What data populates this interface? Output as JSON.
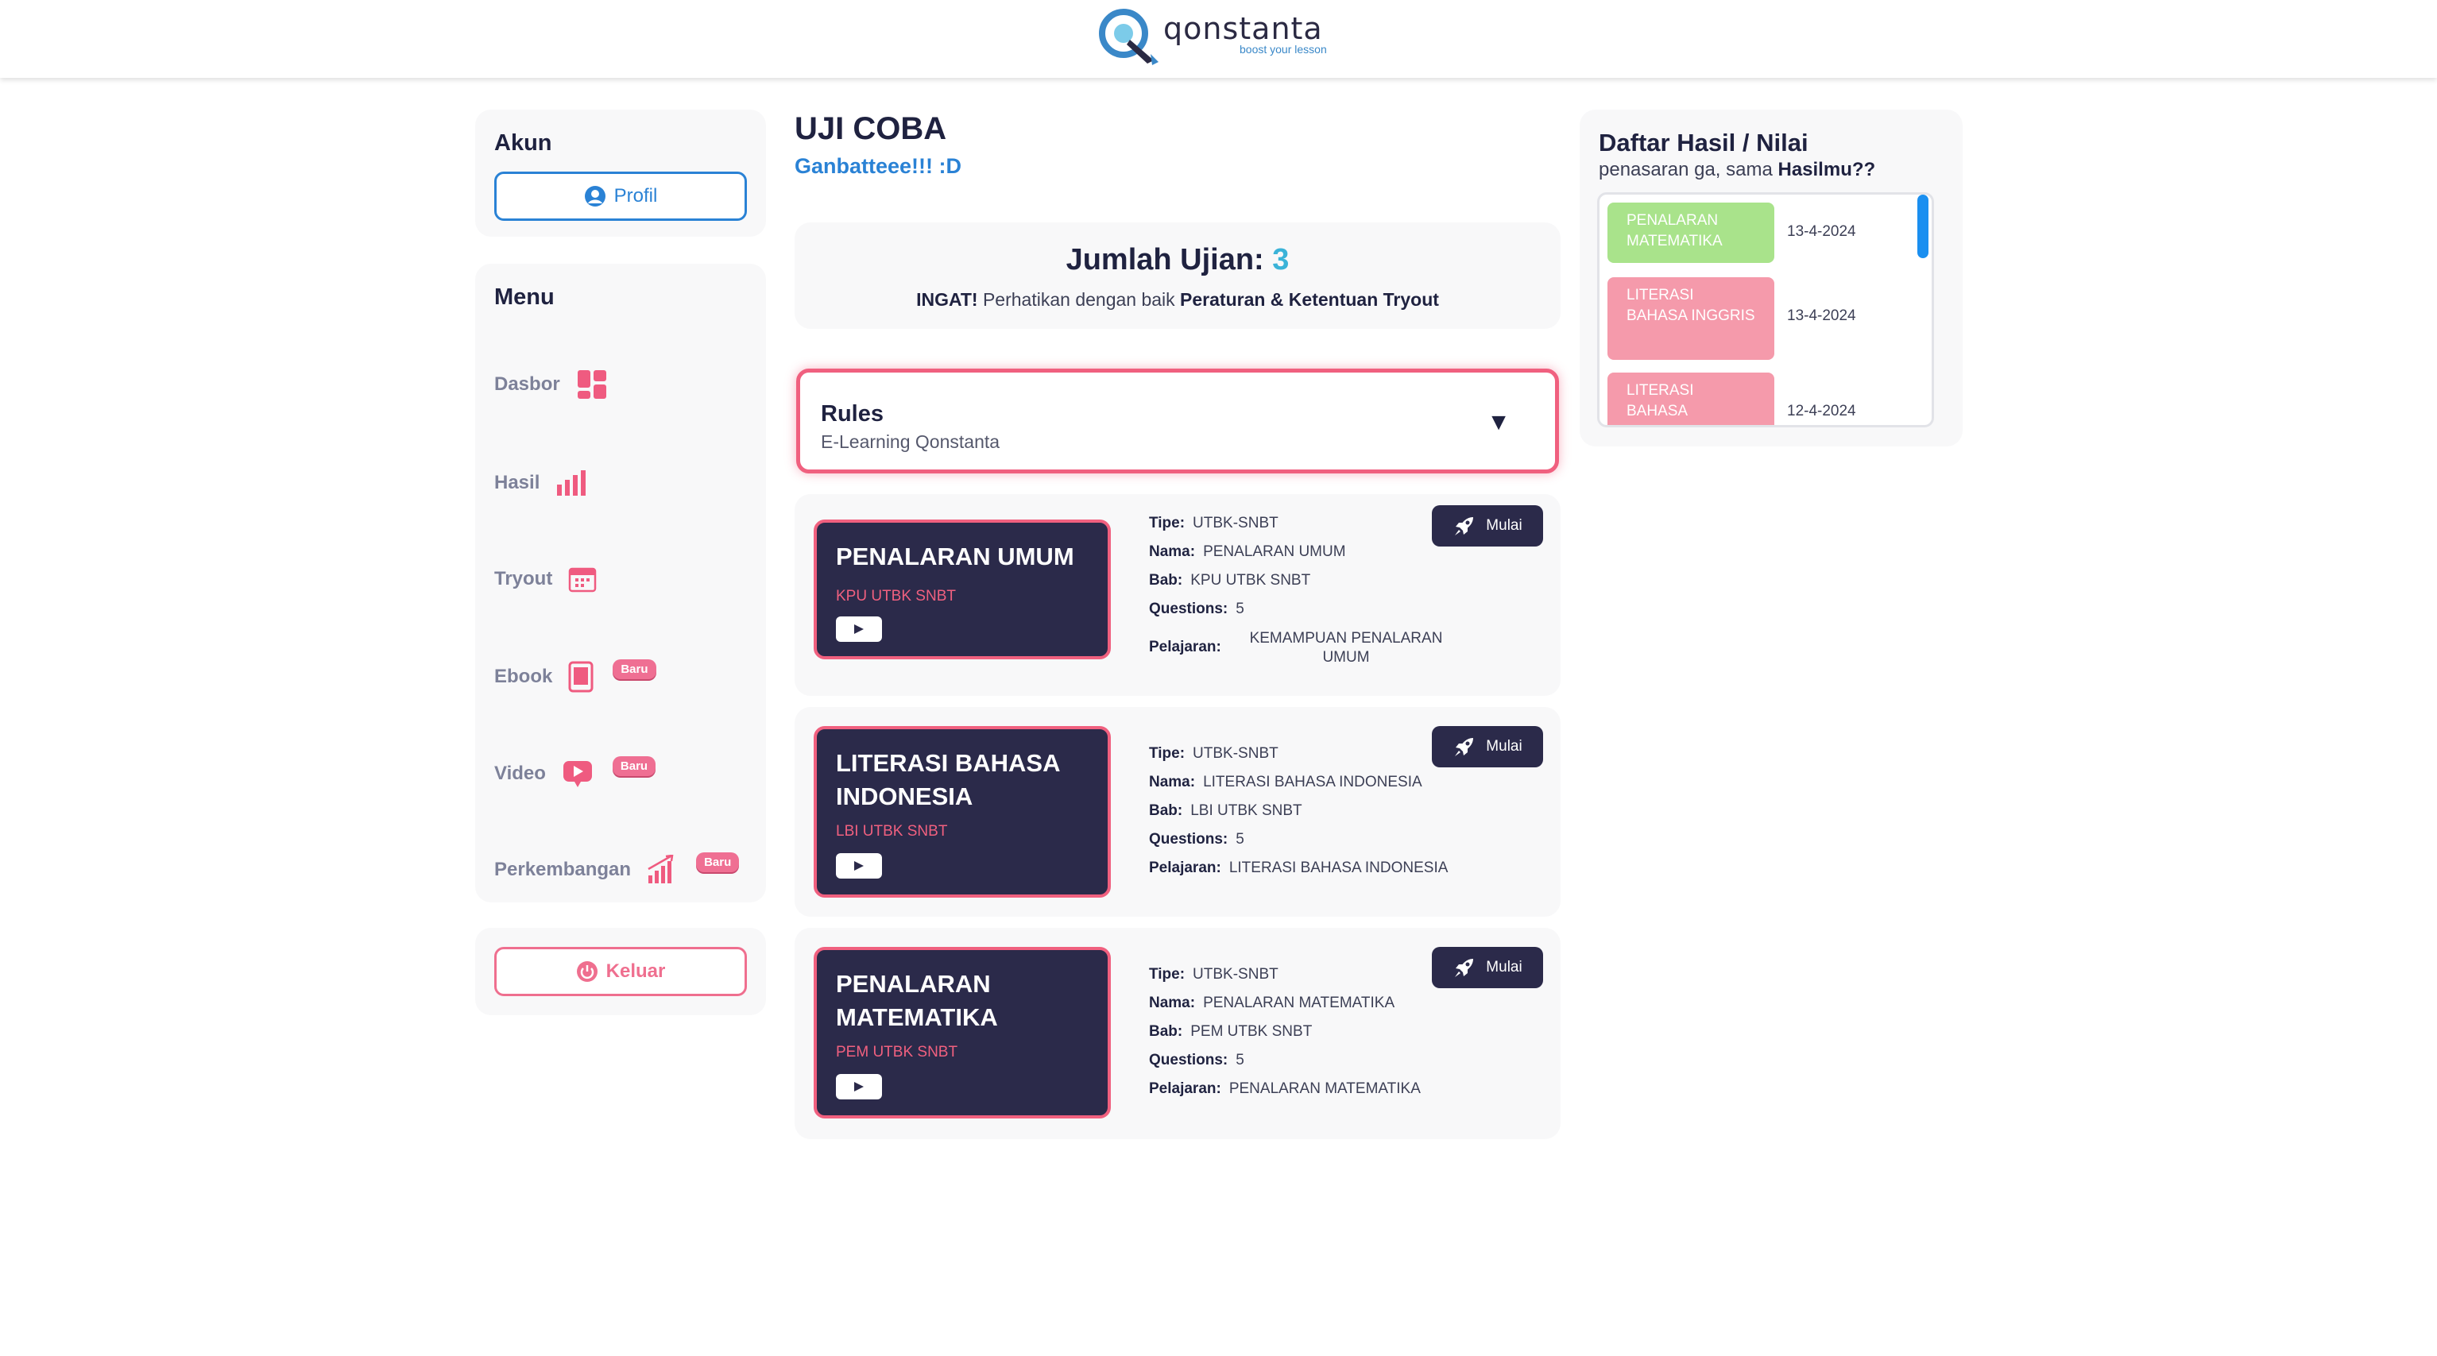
{
  "brand": {
    "name": "qonstanta",
    "tagline": "boost your lesson",
    "accent": "#2a82d5",
    "pink": "#f0607f",
    "navy": "#2b2a4a"
  },
  "sidebar": {
    "akun_title": "Akun",
    "profil_label": "Profil",
    "menu_title": "Menu",
    "items": [
      {
        "label": "Dasbor",
        "icon": "dashboard-icon",
        "badge": ""
      },
      {
        "label": "Hasil",
        "icon": "bar-chart-icon",
        "badge": ""
      },
      {
        "label": "Tryout",
        "icon": "calendar-icon",
        "badge": ""
      },
      {
        "label": "Ebook",
        "icon": "tablet-icon",
        "badge": "Baru"
      },
      {
        "label": "Video",
        "icon": "video-icon",
        "badge": "Baru"
      },
      {
        "label": "Perkembangan",
        "icon": "growth-chart-icon",
        "badge": "Baru"
      }
    ],
    "keluar_label": "Keluar"
  },
  "main": {
    "title": "UJI COBA",
    "subtitle": "Ganbatteee!!! :D",
    "jumlah_label": "Jumlah Ujian:",
    "jumlah_value": "3",
    "ingat_bold": "INGAT!",
    "ingat_text": "Perhatikan dengan baik",
    "ingat_rules": "Peraturan & Ketentuan Tryout",
    "rules_title": "Rules",
    "rules_sub": "E-Learning Qonstanta",
    "exams": [
      {
        "title": "PENALARAN UMUM",
        "code": "KPU UTBK SNBT",
        "tipe": "UTBK-SNBT",
        "nama": "PENALARAN UMUM",
        "bab": "KPU UTBK SNBT",
        "questions": "5",
        "pelajaran": "KEMAMPUAN PENALARAN UMUM",
        "mulai": "Mulai"
      },
      {
        "title": "LITERASI BAHASA INDONESIA",
        "code": "LBI UTBK SNBT",
        "tipe": "UTBK-SNBT",
        "nama": "LITERASI BAHASA INDONESIA",
        "bab": "LBI UTBK SNBT",
        "questions": "5",
        "pelajaran": "LITERASI BAHASA INDONESIA",
        "mulai": "Mulai"
      },
      {
        "title": "PENALARAN MATEMATIKA",
        "code": "PEM UTBK SNBT",
        "tipe": "UTBK-SNBT",
        "nama": "PENALARAN MATEMATIKA",
        "bab": "PEM UTBK SNBT",
        "questions": "5",
        "pelajaran": "PENALARAN MATEMATIKA",
        "mulai": "Mulai"
      }
    ],
    "labels": {
      "tipe": "Tipe:",
      "nama": "Nama:",
      "bab": "Bab:",
      "questions": "Questions:",
      "pelajaran": "Pelajaran:"
    }
  },
  "hasil": {
    "title": "Daftar Hasil / Nilai",
    "sub_text": "penasaran ga, sama",
    "sub_bold": "Hasilmu??",
    "items": [
      {
        "label": "PENALARAN MATEMATIKA",
        "date": "13-4-2024",
        "color": "#a9e38b"
      },
      {
        "label": "LITERASI BAHASA INGGRIS",
        "date": "13-4-2024",
        "color": "#f59aab"
      },
      {
        "label": "LITERASI BAHASA INDONESIA",
        "date": "12-4-2024",
        "color": "#f59aab"
      }
    ]
  }
}
